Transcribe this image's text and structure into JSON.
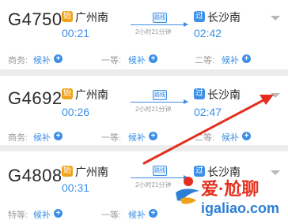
{
  "trains": [
    {
      "number": "G4750",
      "from_badge": "始",
      "from": "广州南",
      "to_badge": "过",
      "to": "长沙南",
      "depart": "00:21",
      "arrive": "02:42",
      "duration": "2小时21分钟",
      "route_icon": "路线",
      "seats": [
        {
          "label": "商务:",
          "status": "候补"
        },
        {
          "label": "一等:",
          "status": "候补"
        },
        {
          "label": "二等:",
          "status": "候补"
        }
      ]
    },
    {
      "number": "G4692",
      "from_badge": "始",
      "from": "广州南",
      "to_badge": "过",
      "to": "长沙南",
      "depart": "00:26",
      "arrive": "02:47",
      "duration": "2小时21分钟",
      "route_icon": "路线",
      "seats": [
        {
          "label": "商务:",
          "status": "候补"
        },
        {
          "label": "一等:",
          "status": "候补"
        },
        {
          "label": "二等:",
          "status": "候补"
        }
      ]
    },
    {
      "number": "G4808",
      "from_badge": "始",
      "from": "广州南",
      "to_badge": "过",
      "to": "长沙南",
      "depart": "00:31",
      "arrive": "",
      "duration": "2小时21分钟",
      "route_icon": "路线",
      "seats": [
        {
          "label": "特等:",
          "status": "候补"
        },
        {
          "label": "一等:",
          "status": "候补"
        },
        {
          "label": "二等:",
          "status": "候补"
        }
      ]
    }
  ],
  "plus_symbol": "+",
  "watermark": {
    "line1": "爱·尬聊",
    "line2": "igaliao.com"
  },
  "colors": {
    "accent": "#3b8fe6",
    "start_badge": "#f0a21a",
    "arrow": "#e52f1e"
  },
  "icons": [
    "chevron-down-icon",
    "route-icon",
    "plus-icon",
    "annotation-arrow",
    "watermark-logo-icon"
  ]
}
